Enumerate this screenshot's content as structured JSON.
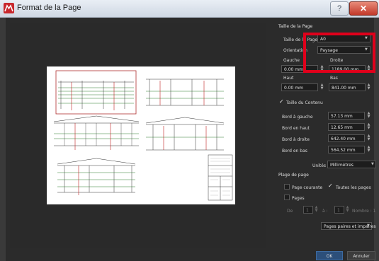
{
  "window": {
    "title": "Format de la Page",
    "help_label": "?",
    "close_label": "✕",
    "logo_icon": "app-logo-icon"
  },
  "page_size": {
    "section_title": "Taille de la Page",
    "size_label": "Taille de la Page",
    "size_value": "A0",
    "orientation_label": "Orientation",
    "orientation_value": "Paysage",
    "left_label": "Gauche",
    "left_value": "0.00 mm",
    "right_label": "Droite",
    "right_value": "1189.00 mm",
    "top_label": "Haut",
    "top_value": "0.00 mm",
    "bottom_label": "Bas",
    "bottom_value": "841.00 mm"
  },
  "content_size": {
    "checkbox_mark": "✓",
    "title": "Taille du Contenu",
    "left_edge_label": "Bord à gauche",
    "left_edge_value": "57.13 mm",
    "top_edge_label": "Bord en haut",
    "top_edge_value": "12.65 mm",
    "right_edge_label": "Bord à droite",
    "right_edge_value": "642.40 mm",
    "bottom_edge_label": "Bord en bas",
    "bottom_edge_value": "564.52 mm"
  },
  "units": {
    "label": "Unités",
    "value": "Millimètres"
  },
  "page_range": {
    "title": "Plage de page",
    "current_page_label": "Page courante",
    "all_pages_mark": "✓",
    "all_pages_label": "Toutes les pages",
    "pages_label": "Pages",
    "from_label": "De",
    "from_value": "1",
    "to_label": "à :",
    "to_value": "1",
    "total_label": "Nombre : 1",
    "parity_value": "Pages paires et impaires"
  },
  "buttons": {
    "ok": "OK",
    "cancel": "Annuler"
  },
  "colors": {
    "accent_highlight": "#e0001b",
    "ok_button": "#2c4f7a",
    "panel_bg": "#2b2b2b"
  }
}
